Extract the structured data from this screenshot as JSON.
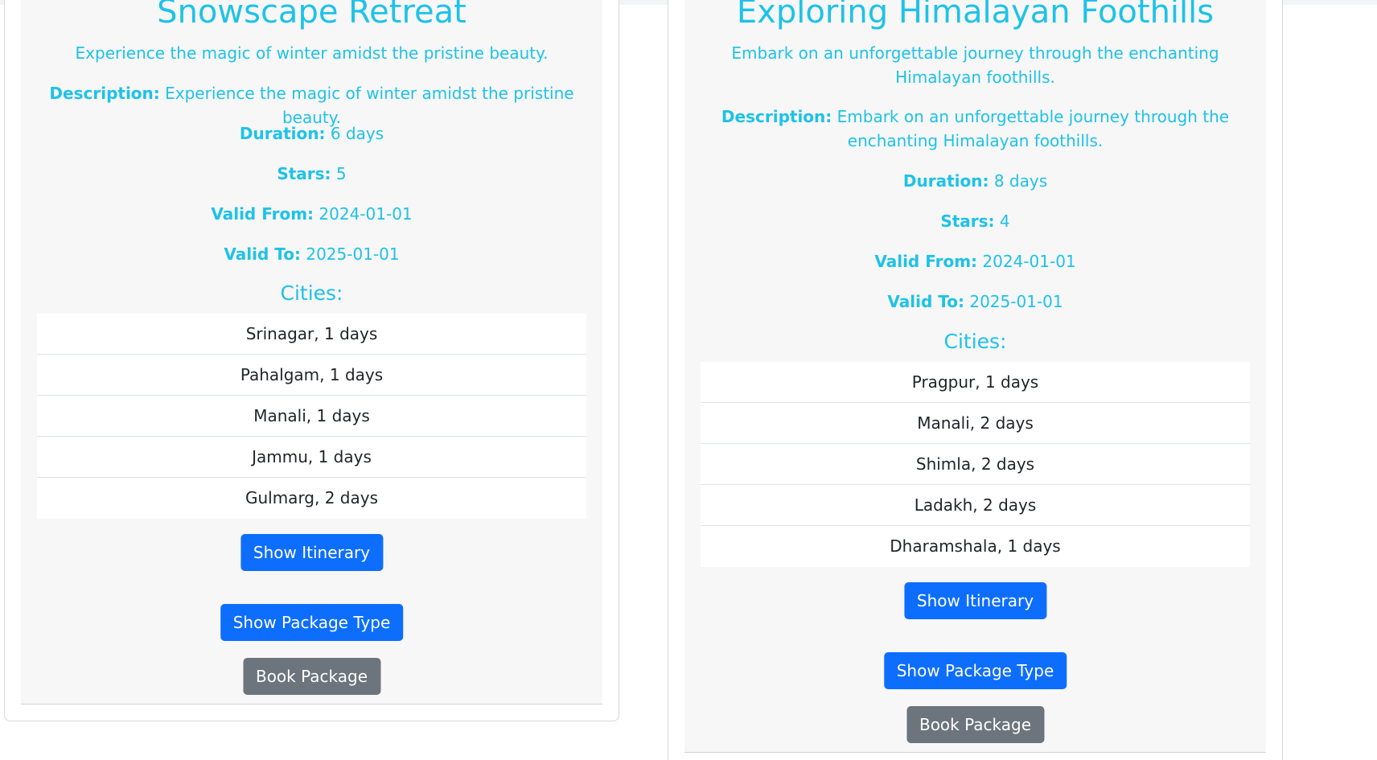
{
  "labels": {
    "description": "Description:",
    "duration": "Duration:",
    "stars": "Stars:",
    "valid_from": "Valid From:",
    "valid_to": "Valid To:",
    "cities_heading": "Cities:",
    "show_itinerary": "Show Itinerary",
    "show_package_type": "Show Package Type",
    "book_package": "Book Package"
  },
  "packages": [
    {
      "title": "Snowscape Retreat",
      "subtitle": "Experience the magic of winter amidst the pristine beauty.",
      "description": "Experience the magic of winter amidst the pristine beauty.",
      "duration": "6 days",
      "stars": "5",
      "valid_from": "2024-01-01",
      "valid_to": "2025-01-01",
      "cities": [
        "Srinagar, 1 days",
        "Pahalgam, 1 days",
        "Manali, 1 days",
        "Jammu, 1 days",
        "Gulmarg, 2 days"
      ]
    },
    {
      "title": "Exploring Himalayan Foothills",
      "subtitle": "Embark on an unforgettable journey through the enchanting Himalayan foothills.",
      "description": "Embark on an unforgettable journey through the enchanting Himalayan foothills.",
      "duration": "8 days",
      "stars": "4",
      "valid_from": "2024-01-01",
      "valid_to": "2025-01-01",
      "cities": [
        "Pragpur, 1 days",
        "Manali, 2 days",
        "Shimla, 2 days",
        "Ladakh, 2 days",
        "Dharamshala, 1 days"
      ]
    }
  ]
}
